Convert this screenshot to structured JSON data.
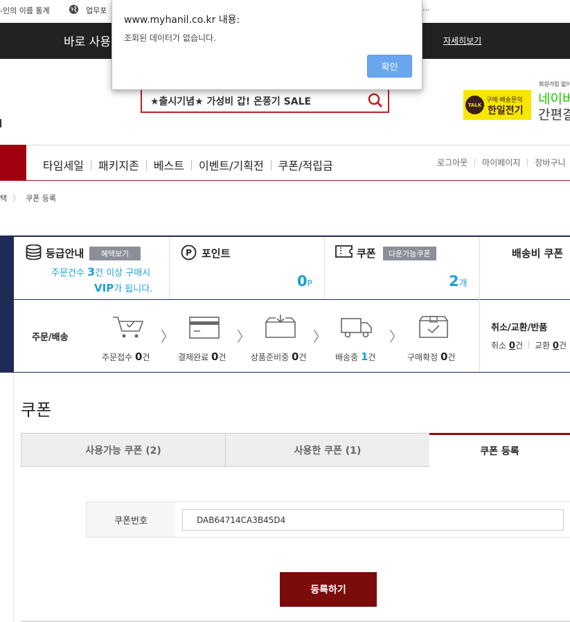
{
  "bookmarks": [
    {
      "label": "-인의 이름 통계"
    },
    {
      "label": "업무포"
    },
    {
      "label": "..."
    }
  ],
  "banner": {
    "text": "바로 사용",
    "more_link": "자세히보기"
  },
  "dialog": {
    "origin": "www.myhanil.co.kr 내용:",
    "message": "조회된 데이터가 없습니다.",
    "ok_label": "확인"
  },
  "search": {
    "value": "★출시기념★ 가성비 갑! 온풍기 SALE"
  },
  "promo": {
    "kakao_badge": "TALK",
    "kakao_line1": "구매·배송문의",
    "kakao_line2": "한일전기",
    "naver_small": "회원가입 없이",
    "naver_line1": "네이버",
    "naver_line2": "간편결"
  },
  "nav": {
    "items": [
      "타임세일",
      "패키지존",
      "베스트",
      "이벤트/기획전",
      "쿠폰/적립금"
    ],
    "util": [
      "로그아웃",
      "마이페이지",
      "장바구니"
    ]
  },
  "breadcrumb": {
    "prev": "택",
    "current": "쿠폰 등록"
  },
  "summary": {
    "grade_title": "등급안내",
    "grade_badge": "혜택보기",
    "grade_line1_a": "주문건수 ",
    "grade_line1_num": "3",
    "grade_line1_b": "건 이상 구매시",
    "grade_line2_vip": "VIP",
    "grade_line2_b": "가 됩니다.",
    "point_title": "포인트",
    "point_value": "0",
    "point_unit": "P",
    "coupon_title": "쿠폰",
    "coupon_badge": "다운가능쿠폰",
    "coupon_value": "2",
    "coupon_unit": "개",
    "shipping_coupon_title": "배송비 쿠폰",
    "order_label": "주문/배송",
    "steps": [
      {
        "label": "주문접수 ",
        "count": "0",
        "unit": "건"
      },
      {
        "label": "결제완료 ",
        "count": "0",
        "unit": "건"
      },
      {
        "label": "상품준비중 ",
        "count": "0",
        "unit": "건"
      },
      {
        "label": "배송중 ",
        "count": "1",
        "unit": "건"
      },
      {
        "label": "구매확정 ",
        "count": "0",
        "unit": "건"
      }
    ],
    "claims_title": "취소/교환/반품",
    "cancel_label": "취소 ",
    "cancel_count": "0",
    "cancel_unit": "건",
    "exchange_label": "교환 ",
    "exchange_count": "0",
    "exchange_unit": "건"
  },
  "page": {
    "title": "쿠폰"
  },
  "tabs": [
    {
      "label": "사용가능 쿠폰 (2)"
    },
    {
      "label": "사용한 쿠폰 (1)"
    },
    {
      "label": "쿠폰 등록"
    }
  ],
  "coupon_form": {
    "field_label": "쿠폰번호",
    "field_value": "DAB64714CA3B45D4",
    "submit_label": "등록하기"
  },
  "colors": {
    "brand_red": "#a1000f",
    "navy": "#1f2a55",
    "accent_cyan": "#1a9fd9",
    "dialog_button": "#6aa6f0"
  }
}
